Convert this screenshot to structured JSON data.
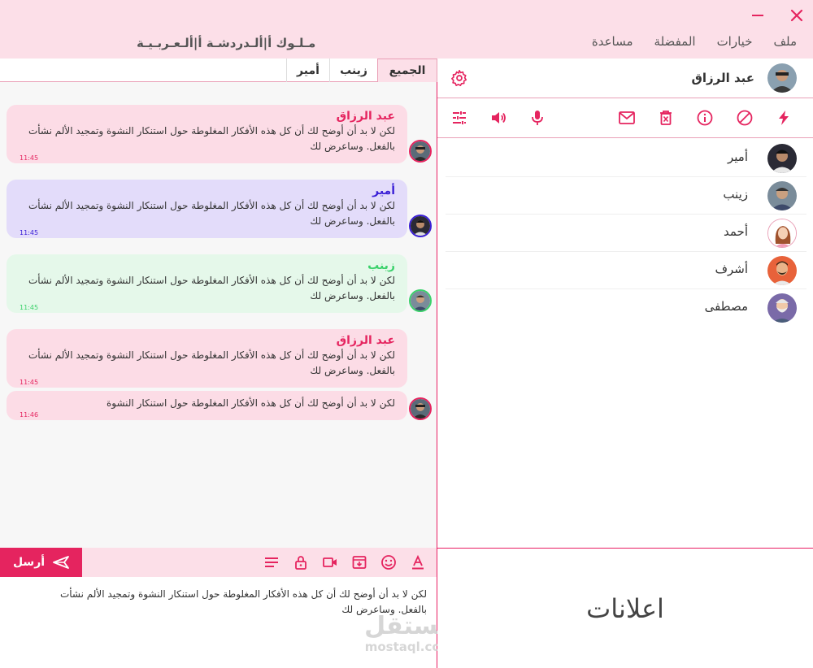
{
  "app": {
    "title": "مـلـوك أ|ألـدردشـة أ|ألـعـربـيـة"
  },
  "menu": {
    "file": "ملف",
    "options": "خيارات",
    "favorites": "المفضلة",
    "help": "مساعدة"
  },
  "tabs": {
    "all": "الجميع",
    "zainab": "زينب",
    "amir": "أمير"
  },
  "messages": [
    {
      "sender": "عبد الرزاق",
      "text": "لكن لا بد أن أوضح لك أن كل هذه الأفكار المغلوطة حول استنكار النشوة وتمجيد الألم نشأت بالفعل. وساعرض لك",
      "time": "11:45",
      "color": "#e5245f"
    },
    {
      "sender": "أمير",
      "text": "لكن لا بد أن أوضح لك أن كل هذه الأفكار المغلوطة حول استنكار النشوة وتمجيد الألم نشأت بالفعل. وساعرض لك",
      "time": "11:45",
      "color": "#3a1fd6"
    },
    {
      "sender": "زينب",
      "text": "لكن لا بد أن أوضح لك أن كل هذه الأفكار المغلوطة حول استنكار النشوة وتمجيد الألم نشأت بالفعل. وساعرض لك",
      "time": "11:45",
      "color": "#3bd16b"
    },
    {
      "sender": "عبد الرزاق",
      "text": "لكن لا بد أن أوضح لك أن كل هذه الأفكار المغلوطة حول استنكار النشوة وتمجيد الألم نشأت بالفعل. وساعرض لك",
      "time": "11:45",
      "color": "#e5245f"
    },
    {
      "sender": "",
      "text": "لكن لا بد أن أوضح لك أن كل هذه الأفكار المغلوطة حول استنكار النشوة",
      "time": "11:46",
      "color": "#e5245f"
    }
  ],
  "composer": {
    "send_label": "أرسل",
    "text": "لكن لا بد أن أوضح لك أن كل هذه الأفكار المغلوطة حول استنكار النشوة وتمجيد الألم نشأت بالفعل. وساعرض لك"
  },
  "watermark": {
    "arabic": "مستقل",
    "latin": "mostaql.com"
  },
  "user": {
    "name": "عبد الرزاق"
  },
  "contacts": [
    {
      "name": "أمير"
    },
    {
      "name": "زينب"
    },
    {
      "name": "أحمد"
    },
    {
      "name": "أشرف"
    },
    {
      "name": "مصطفى"
    }
  ],
  "ads": {
    "label": "اعلانات"
  },
  "colors": {
    "accent": "#e5245f",
    "topbar": "#fcdfe8",
    "bubble_pink": "#fcdce6",
    "bubble_purple": "#e3dcfa",
    "bubble_green": "#e5f8ea"
  },
  "icons": {
    "window": [
      "minimize-icon",
      "close-icon"
    ],
    "actions": [
      "flash-icon",
      "block-icon",
      "info-icon",
      "delete-icon",
      "mail-icon",
      "mic-icon",
      "volume-icon",
      "tune-icon"
    ],
    "composer": [
      "font-color-icon",
      "emoji-icon",
      "archive-icon",
      "video-icon",
      "lock-icon",
      "align-icon",
      "send-icon"
    ]
  }
}
